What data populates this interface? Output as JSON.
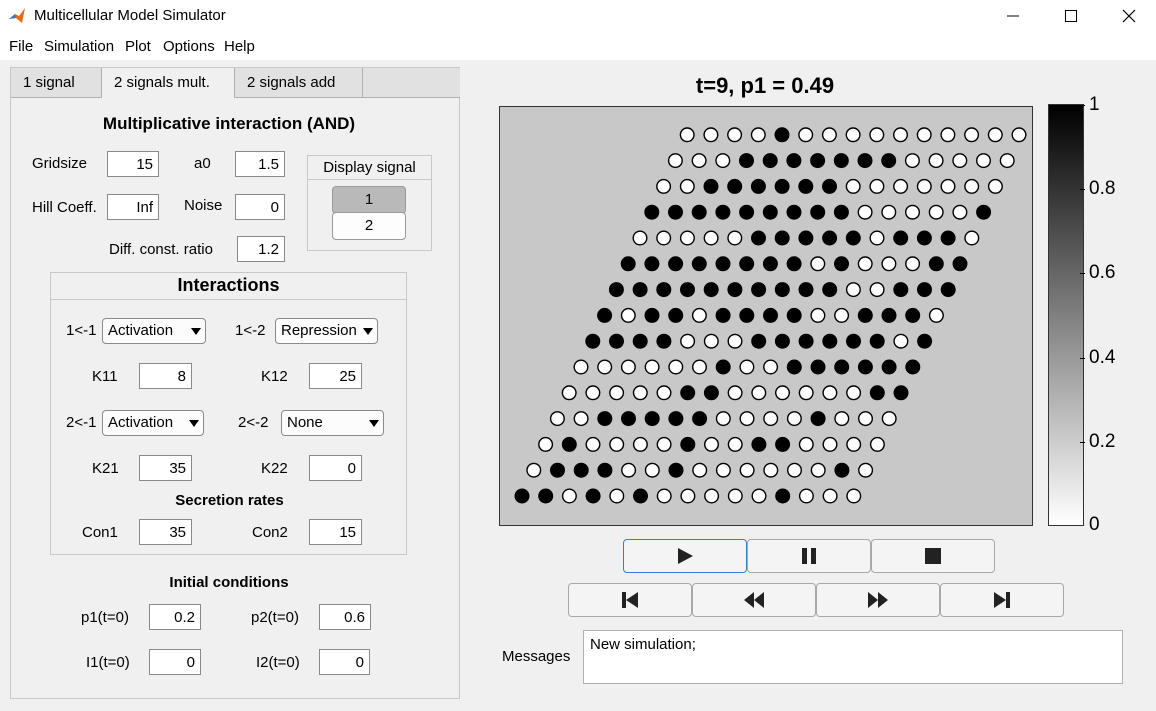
{
  "window": {
    "title": "Multicellular Model Simulator",
    "minimize_icon": "minimize-icon",
    "maximize_icon": "maximize-icon",
    "close_icon": "close-icon"
  },
  "menu": [
    "File",
    "Simulation",
    "Plot",
    "Options",
    "Help"
  ],
  "tabs": [
    "1 signal",
    "2 signals mult.",
    "2 signals add"
  ],
  "active_tab": "2 signals mult.",
  "panel": {
    "heading": "Multiplicative interaction (AND)",
    "gridsize_label": "Gridsize",
    "gridsize": "15",
    "a0_label": "a0",
    "a0": "1.5",
    "hill_label": "Hill Coeff.",
    "hill": "Inf",
    "noise_label": "Noise",
    "noise": "0",
    "diff_label": "Diff. const. ratio",
    "diff": "1.2",
    "display_signal": {
      "title": "Display signal",
      "options": [
        "1",
        "2"
      ],
      "selected": "1"
    }
  },
  "interactions": {
    "title": "Interactions",
    "l11": "1<-1",
    "l11_value": "Activation",
    "l12": "1<-2",
    "l12_value": "Repression",
    "K11_label": "K11",
    "K11": "8",
    "K12_label": "K12",
    "K12": "25",
    "l21": "2<-1",
    "l21_value": "Activation",
    "l22": "2<-2",
    "l22_value": "None",
    "K21_label": "K21",
    "K21": "35",
    "K22_label": "K22",
    "K22": "0",
    "secretion_title": "Secretion rates",
    "con1_label": "Con1",
    "con1": "35",
    "con2_label": "Con2",
    "con2": "15"
  },
  "initial": {
    "title": "Initial conditions",
    "p1_label": "p1(t=0)",
    "p1": "0.2",
    "p2_label": "p2(t=0)",
    "p2": "0.6",
    "I1_label": "I1(t=0)",
    "I1": "0",
    "I2_label": "I2(t=0)",
    "I2": "0"
  },
  "plot": {
    "title": "t=9, p1 = 0.49",
    "grid": [
      "110101000001000",
      "011100100000010",
      "010000100110000",
      "001111100001000",
      "000001100000011",
      "000000100111111",
      "111100011111101",
      "101101111001110",
      "111111111100111",
      "111111110100011",
      "000001111101110",
      "111111111000001",
      "001111110000000",
      "000111111100000",
      "000010000000000"
    ],
    "colorbar_ticks": [
      "1",
      "0.8",
      "0.6",
      "0.4",
      "0.2",
      "0"
    ],
    "colorbar_range": [
      0,
      1
    ]
  },
  "controls": {
    "row1": [
      "play-icon",
      "pause-icon",
      "stop-icon"
    ],
    "row2": [
      "skip-to-start-icon",
      "rewind-icon",
      "fast-forward-icon",
      "skip-to-end-icon"
    ]
  },
  "messages": {
    "label": "Messages",
    "text": "New simulation;"
  }
}
